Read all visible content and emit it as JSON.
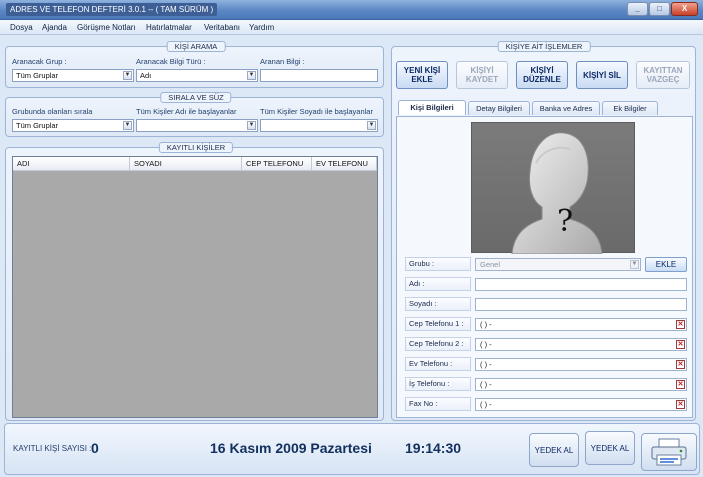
{
  "window": {
    "title": "ADRES VE TELEFON DEFTERİ 3.0.1 -- ( TAM SÜRÜM )",
    "controls": {
      "minimize": "_",
      "maximize": "□",
      "close": "X"
    }
  },
  "menu": [
    "Dosya",
    "Ajanda",
    "Görüşme Notları",
    "Hatırlatmalar",
    "Veritabanı",
    "Yardım"
  ],
  "search_panel": {
    "title": "KİŞİ ARAMA",
    "group_label": "Aranacak Grup :",
    "group_value": "Tüm Gruplar",
    "info_type_label": "Aranacak Bilgi Türü :",
    "info_type_value": "Adı",
    "search_label": "Aranan Bilgi :",
    "search_value": ""
  },
  "sort_panel": {
    "title": "SIRALA VE SÜZ",
    "group_sort_label": "Grubunda olanları sırala",
    "group_sort_value": "Tüm Gruplar",
    "first_name_label": "Tüm Kişiler Adı ile başlayanlar",
    "first_name_value": "",
    "last_name_label": "Tüm Kişiler Soyadı ile başlayanlar",
    "last_name_value": ""
  },
  "contacts_panel": {
    "title": "KAYITLI KİŞİLER",
    "columns": [
      "ADI",
      "SOYADI",
      "CEP TELEFONU",
      "EV TELEFONU"
    ],
    "rows": []
  },
  "actions_panel": {
    "title": "KİŞİYE AİT İŞLEMLER",
    "buttons": [
      {
        "line1": "YENİ KİŞİ",
        "line2": "EKLE",
        "enabled": true
      },
      {
        "line1": "KİŞİYİ",
        "line2": "KAYDET",
        "enabled": false
      },
      {
        "line1": "KİŞİYİ",
        "line2": "DÜZENLE",
        "enabled": true
      },
      {
        "line1": "KİŞİYİ SİL",
        "line2": "",
        "enabled": true
      },
      {
        "line1": "KAYITTAN",
        "line2": "VAZGEÇ",
        "enabled": false
      }
    ],
    "tabs": [
      "Kişi Bilgileri",
      "Detay Bilgileri",
      "Banka ve Adres",
      "Ek Bilgiler"
    ],
    "active_tab": "Kişi Bilgileri",
    "photo_placeholder": "?",
    "fields": {
      "group": {
        "label": "Grubu :",
        "value": "Genel",
        "add_button": "EKLE"
      },
      "first_name": {
        "label": "Adı :",
        "value": ""
      },
      "last_name": {
        "label": "Soyadı :",
        "value": ""
      },
      "mobile1": {
        "label": "Cep Telefonu 1 :",
        "value": "(  )   -"
      },
      "mobile2": {
        "label": "Cep Telefonu 2 :",
        "value": "(  )   -"
      },
      "home_phone": {
        "label": "Ev Telefonu :",
        "value": "(  )   -"
      },
      "work_phone": {
        "label": "İş Telefonu :",
        "value": "(  )   -"
      },
      "fax": {
        "label": "Fax No :",
        "value": "(  )   -"
      }
    },
    "clear_glyph": "✕"
  },
  "status": {
    "count_label": "KAYITLI KİŞİ SAYISI :",
    "count_value": "0",
    "date": "16 Kasım 2009 Pazartesi",
    "time": "19:14:30",
    "backup_button_1": "YEDEK AL",
    "backup_button_2": "YEDEK AL",
    "print_icon": "printer-icon"
  },
  "colors": {
    "titlebar": "#5b87c4",
    "window_bg": "#dce8f6",
    "grid_bg": "#a9a9a9",
    "accent_text": "#12305e"
  }
}
